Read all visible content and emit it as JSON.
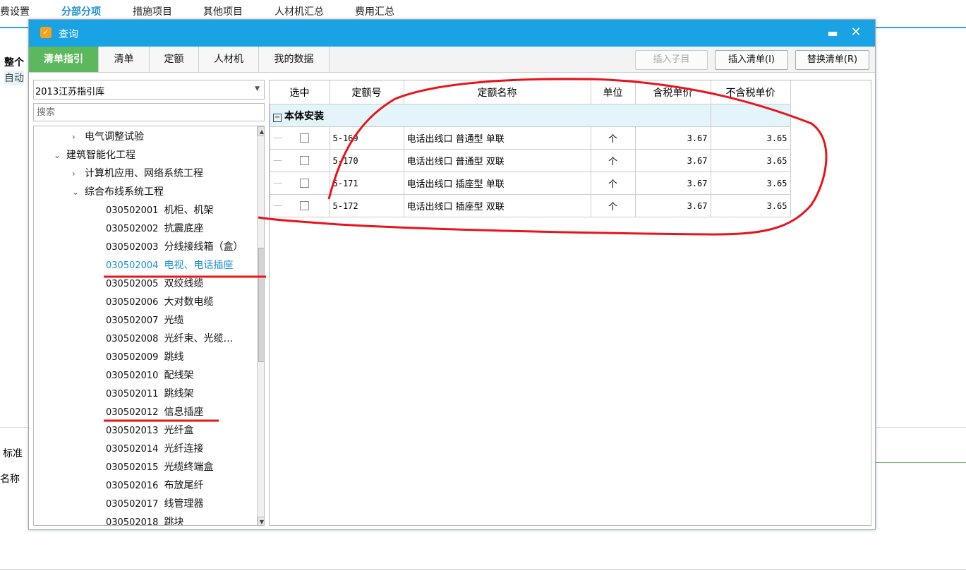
{
  "background": {
    "tabs": [
      "规费设置",
      "分部分项",
      "措施项目",
      "其他项目",
      "人材机汇总",
      "费用汇总"
    ],
    "active_tab": "分部分项",
    "left_labels": [
      "整个",
      "自动",
      "标准",
      "名称"
    ]
  },
  "dialog": {
    "title": "查询",
    "icon": "app-logo-icon",
    "maximize_icon": "maximize-icon",
    "close_icon": "close-icon",
    "tabs": [
      "清单指引",
      "清单",
      "定额",
      "人材机",
      "我的数据"
    ],
    "active_tab": "清单指引",
    "buttons": {
      "insert_sub": "插入子目",
      "insert_list": "插入清单(I)",
      "replace_list": "替换清单(R)"
    },
    "library": "2013江苏指引库",
    "search_placeholder": "搜索",
    "tree": [
      {
        "label": "电气调整试验",
        "arrow": "›",
        "level": 1
      },
      {
        "label": "建筑智能化工程",
        "arrow": "⌄",
        "level": 0
      },
      {
        "label": "计算机应用、网络系统工程",
        "arrow": "›",
        "level": 1
      },
      {
        "label": "综合布线系统工程",
        "arrow": "⌄",
        "level": 1
      },
      {
        "code": "030502001",
        "label": "机柜、机架",
        "level": 2
      },
      {
        "code": "030502002",
        "label": "抗震底座",
        "level": 2
      },
      {
        "code": "030502003",
        "label": "分线接线箱（盒）",
        "level": 2
      },
      {
        "code": "030502004",
        "label": "电视、电话插座",
        "level": 2,
        "selected": true
      },
      {
        "code": "030502005",
        "label": "双绞线缆",
        "level": 2
      },
      {
        "code": "030502006",
        "label": "大对数电缆",
        "level": 2
      },
      {
        "code": "030502007",
        "label": "光缆",
        "level": 2
      },
      {
        "code": "030502008",
        "label": "光纤束、光缆…",
        "level": 2
      },
      {
        "code": "030502009",
        "label": "跳线",
        "level": 2
      },
      {
        "code": "030502010",
        "label": "配线架",
        "level": 2
      },
      {
        "code": "030502011",
        "label": "跳线架",
        "level": 2
      },
      {
        "code": "030502012",
        "label": "信息插座",
        "level": 2
      },
      {
        "code": "030502013",
        "label": "光纤盒",
        "level": 2
      },
      {
        "code": "030502014",
        "label": "光纤连接",
        "level": 2
      },
      {
        "code": "030502015",
        "label": "光缆终端盒",
        "level": 2
      },
      {
        "code": "030502016",
        "label": "布放尾纤",
        "level": 2
      },
      {
        "code": "030502017",
        "label": "线管理器",
        "level": 2
      },
      {
        "code": "030502018",
        "label": "跳块",
        "level": 2
      }
    ],
    "table": {
      "headers": [
        "选中",
        "定额号",
        "定额名称",
        "单位",
        "含税单价",
        "不含税单价"
      ],
      "group": "本体安装",
      "rows": [
        {
          "code": "5-169",
          "name": "电话出线口 普通型 单联",
          "unit": "个",
          "tax_price": "3.67",
          "notax_price": "3.65"
        },
        {
          "code": "5-170",
          "name": "电话出线口 普通型 双联",
          "unit": "个",
          "tax_price": "3.67",
          "notax_price": "3.65"
        },
        {
          "code": "5-171",
          "name": "电话出线口 插座型 单联",
          "unit": "个",
          "tax_price": "3.67",
          "notax_price": "3.65"
        },
        {
          "code": "5-172",
          "name": "电话出线口 插座型 双联",
          "unit": "个",
          "tax_price": "3.67",
          "notax_price": "3.65"
        }
      ]
    }
  },
  "annotation_color": "#e8141c"
}
